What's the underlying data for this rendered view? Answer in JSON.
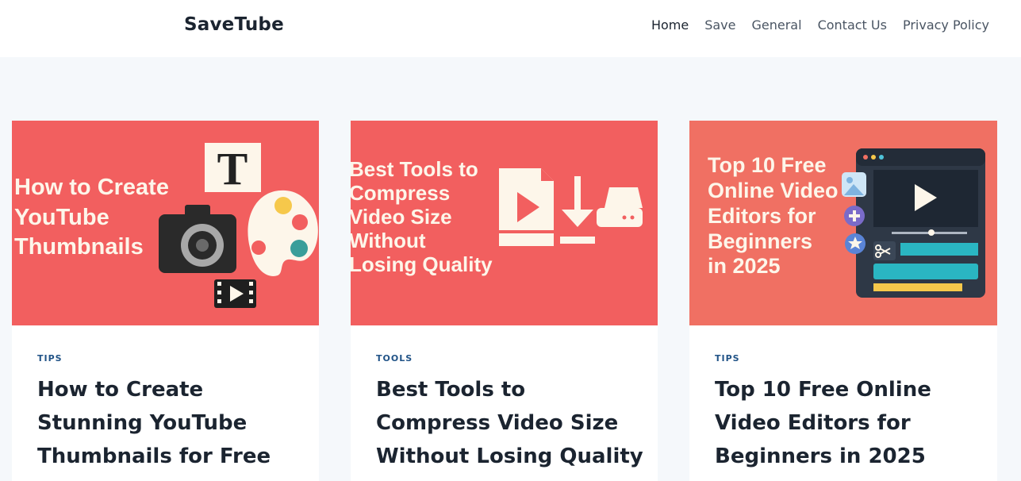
{
  "header": {
    "logo": "SaveTube",
    "nav": [
      {
        "label": "Home",
        "active": true
      },
      {
        "label": "Save"
      },
      {
        "label": "General"
      },
      {
        "label": "Contact Us"
      },
      {
        "label": "Privacy Policy"
      }
    ]
  },
  "colors": {
    "card1_bg": "#f25f5f",
    "card2_bg": "#f25f5f",
    "card3_bg": "#f07063",
    "category": "#215387",
    "title": "#1b2430"
  },
  "posts": [
    {
      "category": "TIPS",
      "title": "How to Create Stunning YouTube Thumbnails for Free",
      "image_text": [
        "How to Create",
        "YouTube",
        "Thumbnails"
      ],
      "image_icons": [
        "text-t-icon",
        "camera-icon",
        "palette-icon",
        "film-play-icon"
      ]
    },
    {
      "category": "TOOLS",
      "title": "Best Tools to Compress Video Size Without Losing Quality",
      "image_text": [
        "Best Tools to",
        "Compress",
        "Video Size",
        "Without",
        "Losing Quality"
      ],
      "image_icons": [
        "video-file-icon",
        "download-arrow-icon",
        "hard-drive-icon"
      ]
    },
    {
      "category": "TIPS",
      "title": "Top 10 Free Online Video Editors for Beginners in 2025",
      "image_text": [
        "Top 10 Free",
        "Online Video",
        "Editors for",
        "Beginners",
        "in 2025"
      ],
      "image_icons": [
        "image-icon",
        "plus-icon",
        "star-icon",
        "video-editor-window-icon",
        "scissors-icon"
      ]
    }
  ]
}
